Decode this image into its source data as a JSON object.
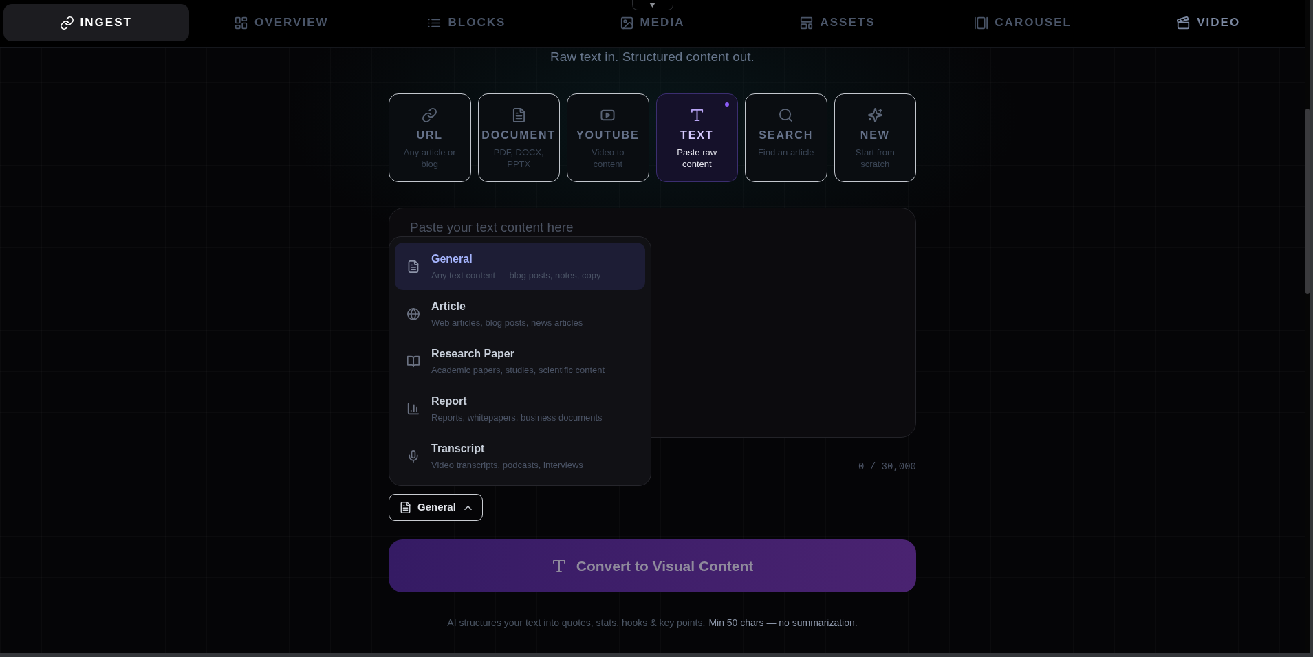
{
  "nav": {
    "tabs": [
      {
        "label": "INGEST",
        "selected": true,
        "disabled": false
      },
      {
        "label": "OVERVIEW",
        "selected": false,
        "disabled": true
      },
      {
        "label": "BLOCKS",
        "selected": false,
        "disabled": true
      },
      {
        "label": "MEDIA",
        "selected": false,
        "disabled": true
      },
      {
        "label": "ASSETS",
        "selected": false,
        "disabled": true
      },
      {
        "label": "CAROUSEL",
        "selected": false,
        "disabled": true
      },
      {
        "label": "VIDEO",
        "selected": false,
        "disabled": false
      }
    ]
  },
  "subtitle": "Raw text in. Structured content out.",
  "sources": [
    {
      "title": "URL",
      "description": "Any article or blog",
      "selected": false
    },
    {
      "title": "DOCUMENT",
      "description": "PDF, DOCX, PPTX",
      "selected": false
    },
    {
      "title": "YOUTUBE",
      "description": "Video to content",
      "selected": false
    },
    {
      "title": "TEXT",
      "description": "Paste raw content",
      "selected": true
    },
    {
      "title": "SEARCH",
      "description": "Find an article",
      "selected": false
    },
    {
      "title": "NEW",
      "description": "Start from scratch",
      "selected": false
    }
  ],
  "editor": {
    "placeholder": "Paste your text content here",
    "counter": "0 / 30,000"
  },
  "content_type": {
    "label": "General",
    "expanded": true,
    "options": [
      {
        "title": "General",
        "description": "Any text content — blog posts, notes, copy",
        "selected": true
      },
      {
        "title": "Article",
        "description": "Web articles, blog posts, news articles",
        "selected": false
      },
      {
        "title": "Research Paper",
        "description": "Academic papers, studies, scientific content",
        "selected": false
      },
      {
        "title": "Report",
        "description": "Reports, whitepapers, business documents",
        "selected": false
      },
      {
        "title": "Transcript",
        "description": "Video transcripts, podcasts, interviews",
        "selected": false
      }
    ]
  },
  "convert_button": {
    "label": "Convert to Visual Content",
    "disabled": true
  },
  "footer": {
    "note": "AI structures your text into quotes, stats, hooks & key points.",
    "requirement": "Min 50 chars — no summarization."
  }
}
